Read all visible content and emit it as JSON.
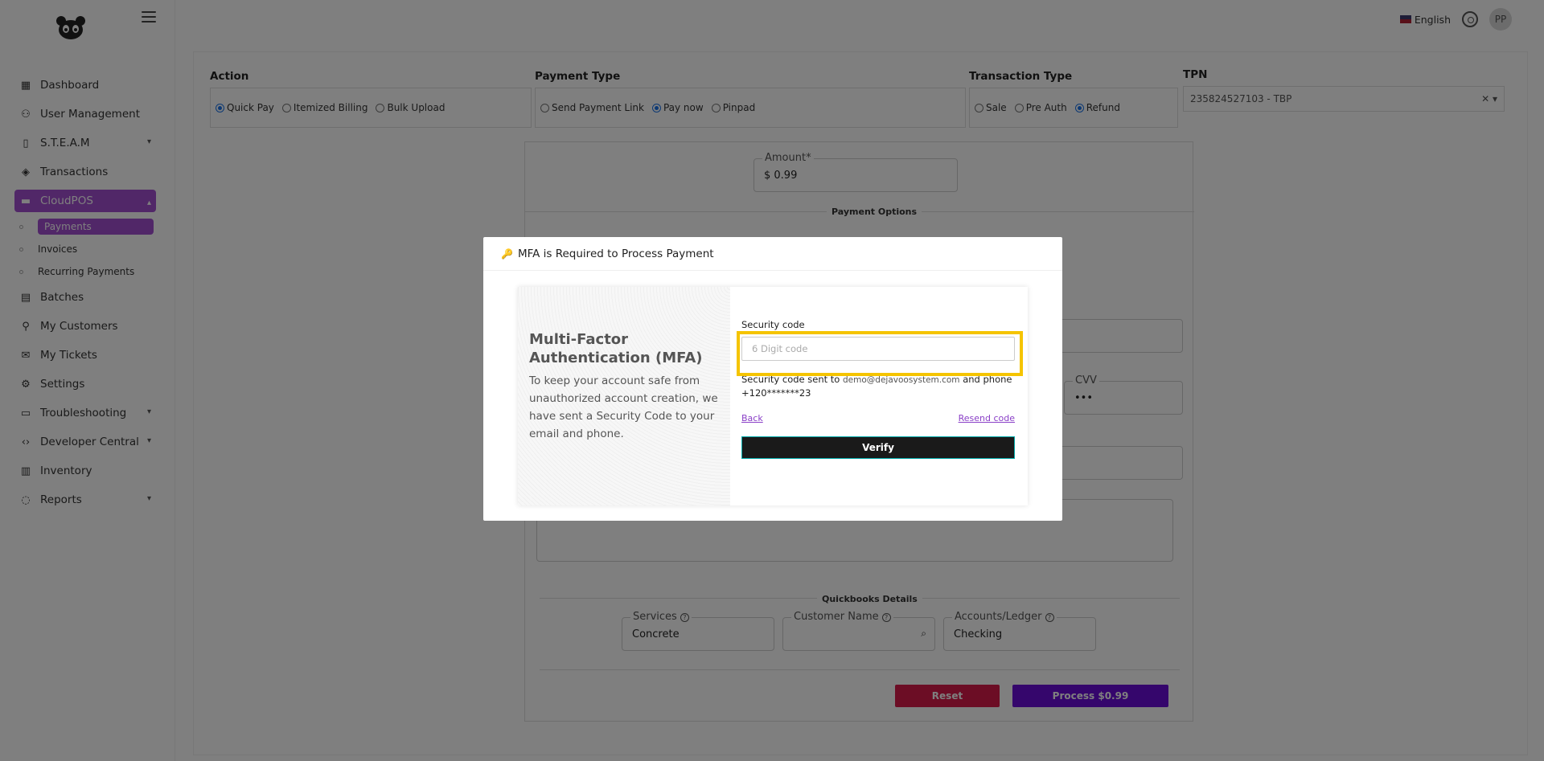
{
  "sidebar": {
    "items": [
      {
        "label": "Dashboard",
        "icon": "grid-icon"
      },
      {
        "label": "User Management",
        "icon": "user-icon"
      },
      {
        "label": "S.T.E.A.M",
        "icon": "device-icon",
        "expandable": true
      },
      {
        "label": "Transactions",
        "icon": "layers-icon"
      },
      {
        "label": "CloudPOS",
        "icon": "card-icon",
        "expandable": true,
        "active": true
      },
      {
        "label": "Batches",
        "icon": "file-icon"
      },
      {
        "label": "My Customers",
        "icon": "person-icon"
      },
      {
        "label": "My Tickets",
        "icon": "inbox-icon"
      },
      {
        "label": "Settings",
        "icon": "gear-icon"
      },
      {
        "label": "Troubleshooting",
        "icon": "monitor-icon",
        "expandable": true
      },
      {
        "label": "Developer Central",
        "icon": "code-icon",
        "expandable": true
      },
      {
        "label": "Inventory",
        "icon": "doc-icon"
      },
      {
        "label": "Reports",
        "icon": "chat-icon",
        "expandable": true
      }
    ],
    "cloudpos_sub": [
      {
        "label": "Payments",
        "active": true
      },
      {
        "label": "Invoices"
      },
      {
        "label": "Recurring Payments"
      }
    ]
  },
  "topbar": {
    "language": "English",
    "avatar_initials": "PP"
  },
  "form": {
    "action": {
      "title": "Action",
      "options": [
        "Quick Pay",
        "Itemized Billing",
        "Bulk Upload"
      ],
      "selected": "Quick Pay"
    },
    "payment_type": {
      "title": "Payment Type",
      "options": [
        "Send Payment Link",
        "Pay now",
        "Pinpad"
      ],
      "selected": "Pay now"
    },
    "transaction_type": {
      "title": "Transaction Type",
      "options": [
        "Sale",
        "Pre Auth",
        "Refund"
      ],
      "selected": "Refund"
    },
    "tpn": {
      "title": "TPN",
      "value": "235824527103 - TBP"
    },
    "amount_label": "Amount*",
    "amount_value": "$ 0.99",
    "payment_options_title": "Payment Options",
    "cvv_label": "CVV",
    "cvv_value": "•••",
    "quickbooks_title": "Quickbooks Details",
    "services_label": "Services",
    "services_value": "Concrete",
    "customer_name_label": "Customer Name",
    "accounts_label": "Accounts/Ledger",
    "accounts_value": "Checking",
    "reset_label": "Reset",
    "process_label": "Process $0.99"
  },
  "modal": {
    "title": "MFA is Required to Process Payment",
    "heading": "Multi-Factor Authentication (MFA)",
    "description": "To keep your account safe from unauthorized account creation, we have sent a Security Code to your email and phone.",
    "security_label": "Security code",
    "code_placeholder": "6 Digit code",
    "sent_prefix": "Security code sent to ",
    "sent_email": "demo@dejavoosystem.com",
    "sent_mid": " and phone",
    "phone": "+120*******23",
    "back_label": "Back",
    "resend_label": "Resend code",
    "verify_label": "Verify"
  },
  "colors": {
    "accent_purple": "#a24fd1",
    "process_purple": "#6a0dd8",
    "reset_red": "#d81b4a",
    "highlight_yellow": "#f5c400"
  }
}
